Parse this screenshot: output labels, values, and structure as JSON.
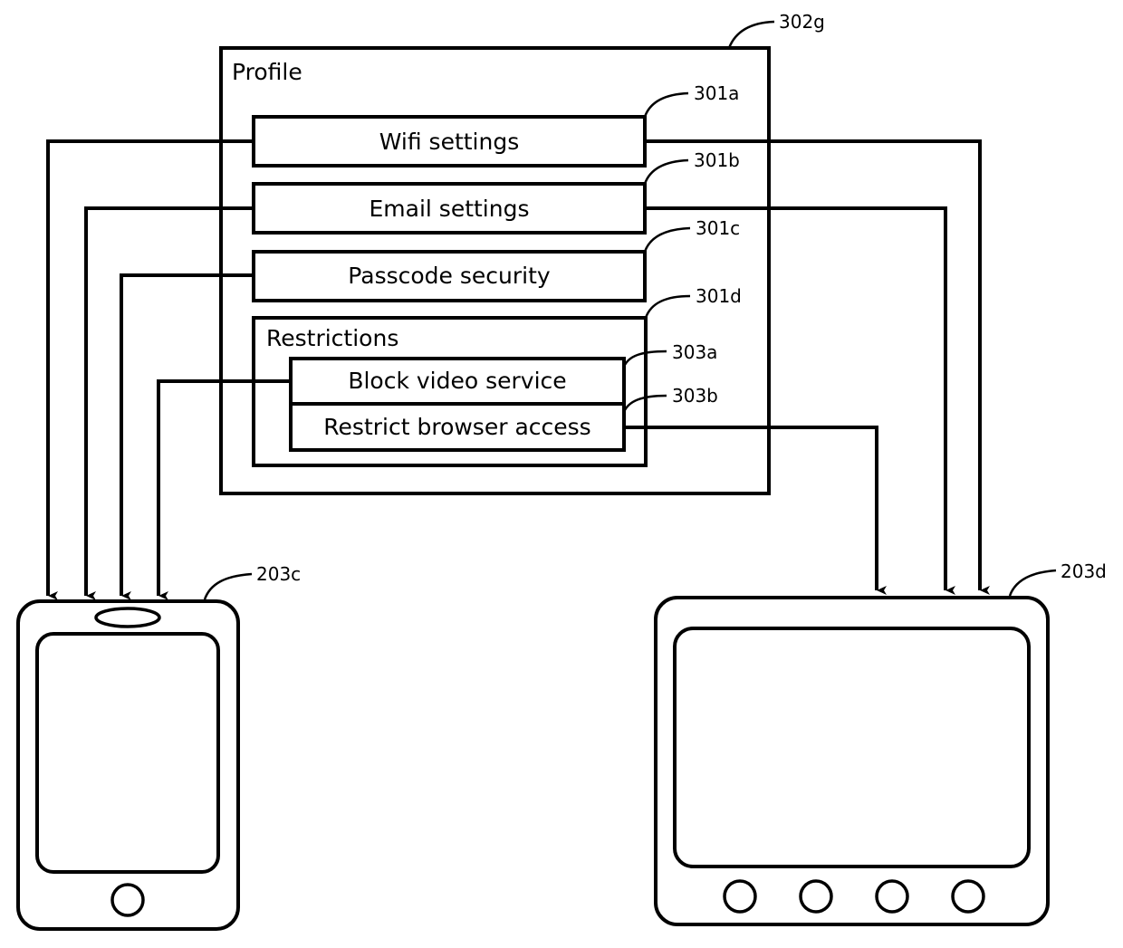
{
  "profile": {
    "title": "Profile",
    "ref": "302g",
    "items": [
      {
        "label": "Wifi settings",
        "ref": "301a"
      },
      {
        "label": "Email settings",
        "ref": "301b"
      },
      {
        "label": "Passcode security",
        "ref": "301c"
      }
    ],
    "restrictions": {
      "title": "Restrictions",
      "ref": "301d",
      "items": [
        {
          "label": "Block video service",
          "ref": "303a"
        },
        {
          "label": "Restrict browser access",
          "ref": "303b"
        }
      ]
    }
  },
  "devices": {
    "phone": {
      "ref": "203c"
    },
    "tablet": {
      "ref": "203d"
    }
  },
  "connections": [
    {
      "from": "Wifi settings",
      "to": [
        "203c",
        "203d"
      ]
    },
    {
      "from": "Email settings",
      "to": [
        "203c",
        "203d"
      ]
    },
    {
      "from": "Passcode security",
      "to": [
        "203c"
      ]
    },
    {
      "from": "Block video service",
      "to": [
        "203c"
      ]
    },
    {
      "from": "Restrict browser access",
      "to": [
        "203d"
      ]
    }
  ]
}
